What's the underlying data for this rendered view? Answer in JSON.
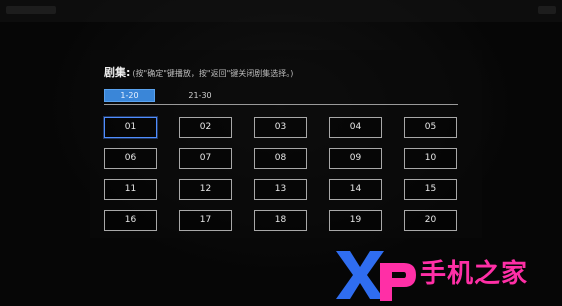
{
  "topbar": {
    "title": "",
    "right_label": ""
  },
  "episode_dialog": {
    "title": "剧集:",
    "hint": "(按\"确定\"键播放，按\"返回\"键关闭剧集选择。)",
    "range_tabs": [
      {
        "label": "1-20",
        "selected": true
      },
      {
        "label": "21-30",
        "selected": false
      }
    ],
    "episodes": [
      "01",
      "02",
      "03",
      "04",
      "05",
      "06",
      "07",
      "08",
      "09",
      "10",
      "11",
      "12",
      "13",
      "14",
      "15",
      "16",
      "17",
      "18",
      "19",
      "20"
    ],
    "selected_episode": "01"
  },
  "watermark": {
    "logo_text": "Xp",
    "text": "手机之家"
  },
  "colors": {
    "background": "#060606",
    "accent": "#3a86d8",
    "episode_border": "#a8a8a8",
    "watermark": "#ff2fa6"
  }
}
